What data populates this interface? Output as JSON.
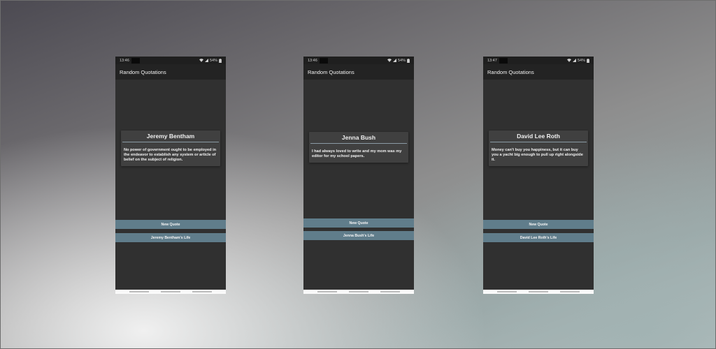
{
  "phones": [
    {
      "status": {
        "time": "13:46",
        "battery": "54%"
      },
      "app_title": "Random Quotations",
      "quote": {
        "author": "Jeremy Bentham",
        "text": "No power of government ought to be employed in the endeavor to establish any system or article of belief on the subject of religion."
      },
      "buttons": {
        "new_quote": "New Quote",
        "life": "Jeremy Bentham's Life"
      }
    },
    {
      "status": {
        "time": "13:46",
        "battery": "54%"
      },
      "app_title": "Random Quotations",
      "quote": {
        "author": "Jenna Bush",
        "text": "I had always loved to write and my mom was my editor for my school papers."
      },
      "buttons": {
        "new_quote": "New Quote",
        "life": "Jenna Bush's Life"
      }
    },
    {
      "status": {
        "time": "13:47",
        "battery": "54%"
      },
      "app_title": "Random Quotations",
      "quote": {
        "author": "David Lee Roth",
        "text": "Money can't buy you happiness, but it can buy you a yacht big enough to pull up right alongside it."
      },
      "buttons": {
        "new_quote": "New Quote",
        "life": "David Lee Roth's Life"
      }
    }
  ],
  "colors": {
    "app_bar": "#232323",
    "screen_bg": "#303030",
    "card_bg": "#404040",
    "button_bg": "#607d8b"
  },
  "icons": [
    "wifi-icon",
    "signal-icon",
    "battery-icon"
  ]
}
